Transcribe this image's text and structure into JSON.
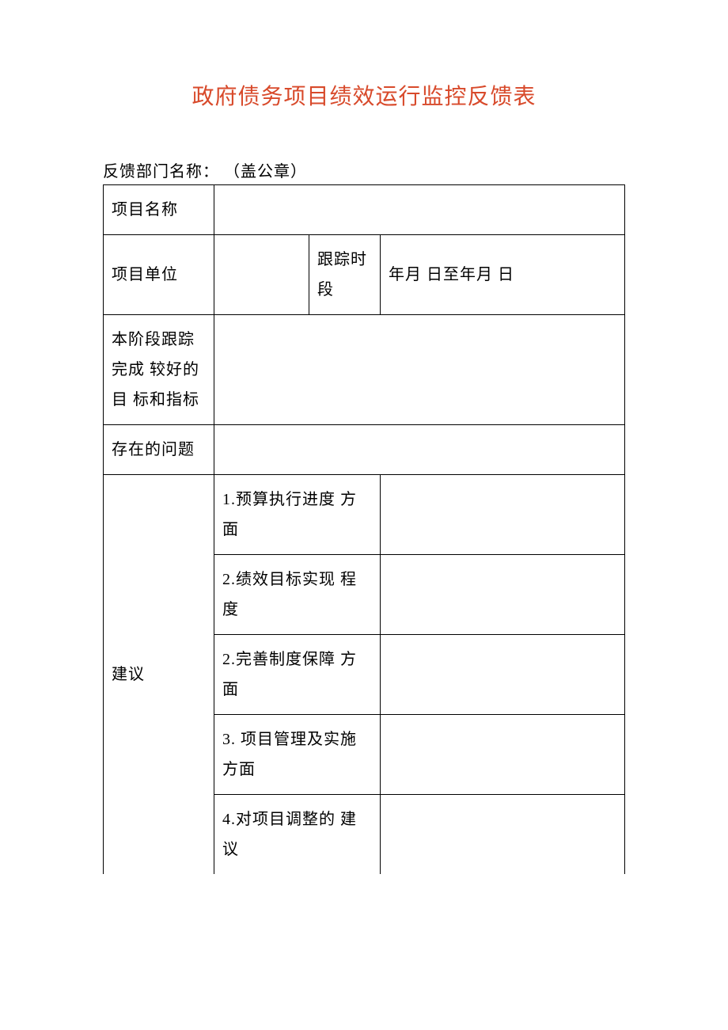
{
  "title": "政府债务项目绩效运行监控反馈表",
  "dept_label": "反馈部门名称： （盖公章）",
  "rows": {
    "project_name_label": "项目名称",
    "project_unit_label": "项目单位",
    "track_period_label": "跟踪时段",
    "track_period_value": "年月  日至年月  日",
    "good_targets_label": "本阶段跟踪完成 较好的目 标和指标",
    "problems_label": "存在的问题",
    "suggestion_label": "建议",
    "sugg1": " 1.预算执行进度 方面",
    "sugg2": " 2.绩效目标实现 程度",
    "sugg3": " 2.完善制度保障 方面",
    "sugg4": " 3. 项目管理及实施方面",
    "sugg5": " 4.对项目调整的 建议"
  }
}
